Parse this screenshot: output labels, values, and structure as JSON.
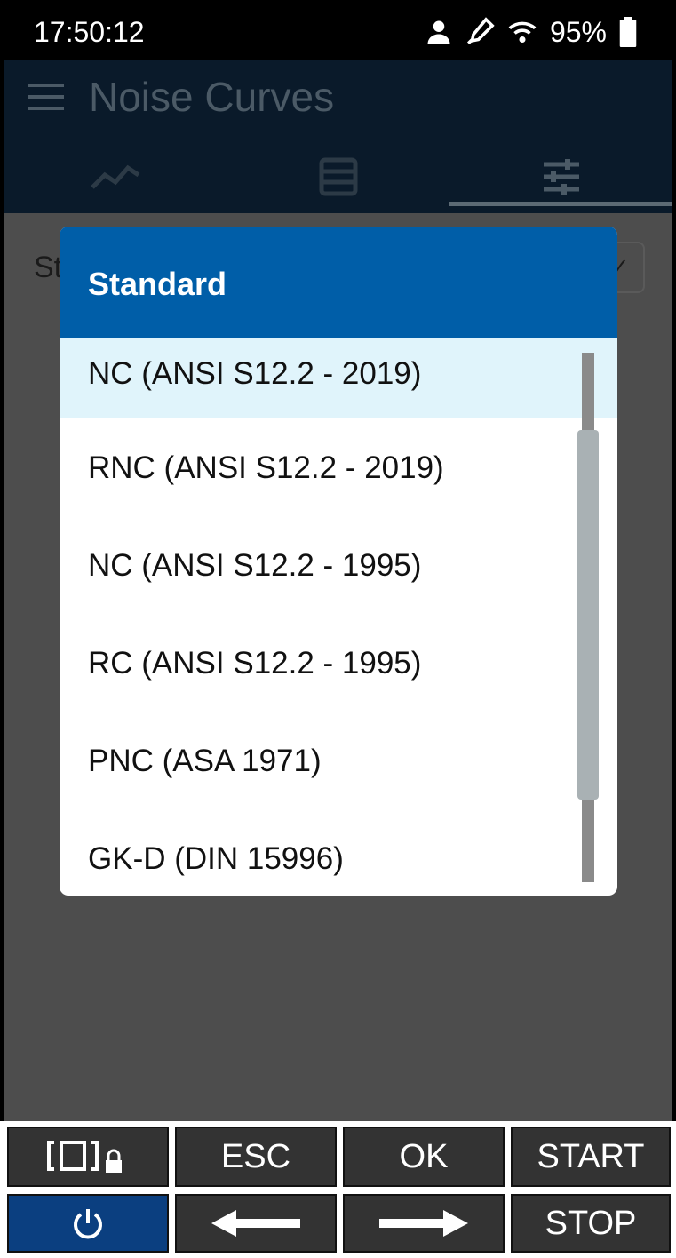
{
  "status_bar": {
    "time": "17:50:12",
    "battery_percent": "95%",
    "icons": [
      "person-icon",
      "probe-icon",
      "wifi-icon",
      "battery-icon"
    ]
  },
  "app_bar": {
    "title": "Noise Curves",
    "menu_icon": "hamburger-menu-icon",
    "tabs": [
      {
        "icon": "chart-icon"
      },
      {
        "icon": "table-icon"
      },
      {
        "icon": "settings-sliders-icon",
        "active": true
      }
    ]
  },
  "background": {
    "field_label": "St"
  },
  "dialog": {
    "title": "Standard",
    "options": [
      "NC (ANSI S12.2 - 2019)",
      "RNC (ANSI S12.2 - 2019)",
      "NC (ANSI S12.2 - 1995)",
      "RC (ANSI S12.2 - 1995)",
      "PNC (ASA 1971)",
      "GK-D (DIN 15996)"
    ],
    "selected_index": 0
  },
  "keys": {
    "esc": "ESC",
    "ok": "OK",
    "start": "START",
    "stop": "STOP"
  },
  "colors": {
    "accent": "#005ea8",
    "selected_row": "#e0f4fb",
    "power_key": "#0b3f80"
  }
}
